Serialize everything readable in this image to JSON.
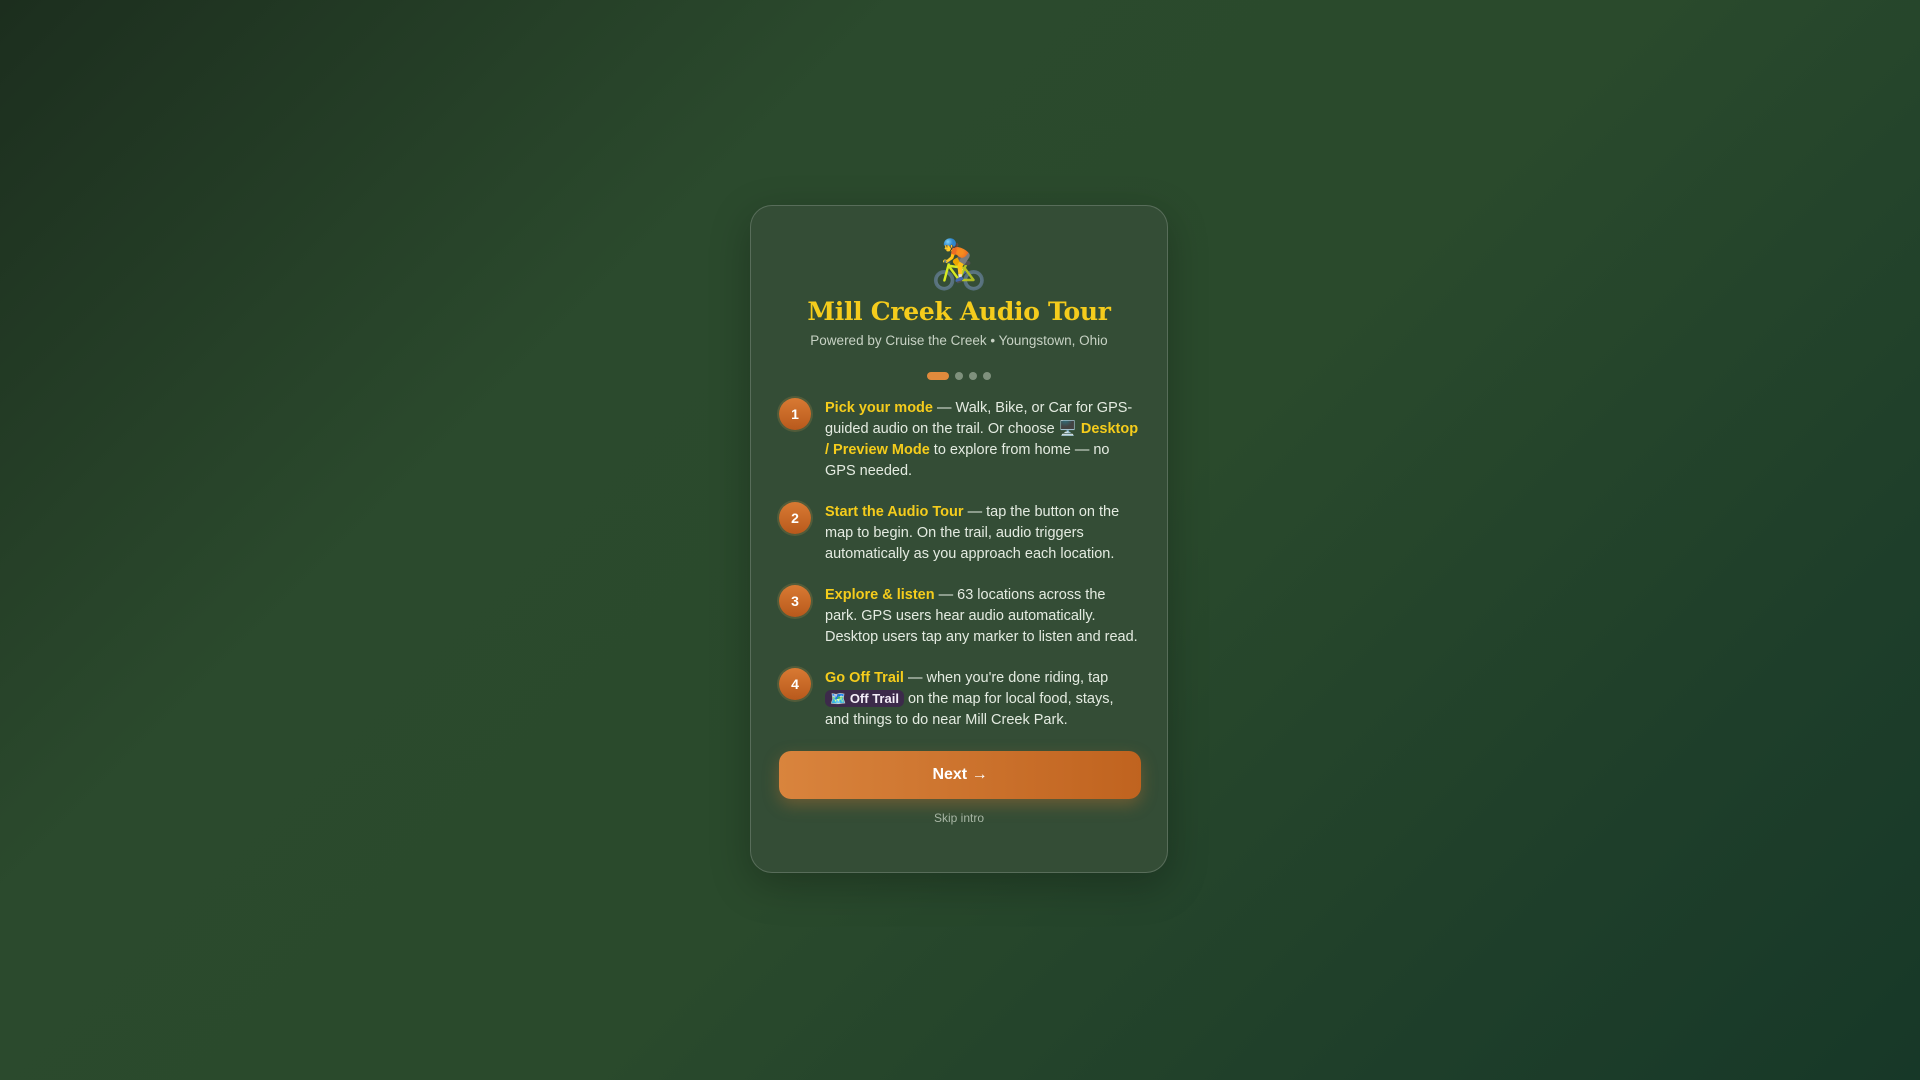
{
  "intro": {
    "logo_emoji": "🚴",
    "title": "Mill Creek Audio Tour",
    "subtitle": "Powered by Cruise the Creek • Youngstown, Ohio",
    "progress": {
      "current_step": 1,
      "total_steps": 4
    },
    "steps": [
      {
        "number": "1",
        "heading": "Pick your mode",
        "text_a": " — Walk, Bike, or Car for GPS-guided audio on the trail. Or choose ",
        "icon_glyph": "🖥️",
        "highlight": "Desktop / Preview Mode",
        "text_b": " to explore from home — no GPS needed."
      },
      {
        "number": "2",
        "heading": "Start the Audio Tour",
        "text_a": " — tap the button on the map to begin. On the trail, audio triggers automatically as you approach each location."
      },
      {
        "number": "3",
        "heading": "Explore & listen",
        "text_a": " — 63 locations across the park. GPS users hear audio automatically. Desktop users tap any marker to listen and read."
      },
      {
        "number": "4",
        "heading": "Go Off Trail",
        "text_a": " — when you're done riding, tap ",
        "pill_icon": "🗺️",
        "pill_label": "Off Trail",
        "text_b": " on the map for local food, stays, and things to do near Mill Creek Park."
      }
    ],
    "next_label": "Next →",
    "skip_label": "Skip intro"
  },
  "colors": {
    "accent_orange": "#d9843d",
    "highlight_yellow": "#f5cc1c",
    "card_bg": "#344d36",
    "pill_bg": "#3c2a4a"
  }
}
